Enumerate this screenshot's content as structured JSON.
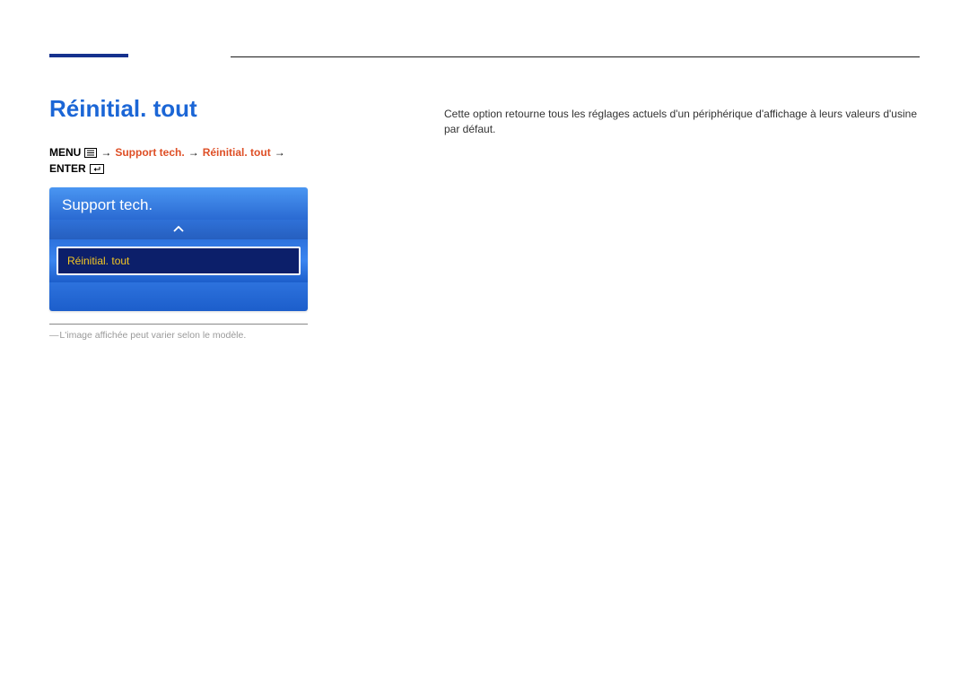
{
  "title": "Réinitial. tout",
  "breadcrumb": {
    "menu_label": "MENU",
    "arrow": "→",
    "path_highlight": "Support tech.",
    "path_highlight2": "Réinitial. tout",
    "enter_label": "ENTER"
  },
  "menu_widget": {
    "header": "Support tech.",
    "selected_item": "Réinitial. tout"
  },
  "footnote": "L'image affichée peut varier selon le modèle.",
  "description": "Cette option retourne tous les réglages actuels d'un périphérique d'affichage à leurs valeurs d'usine par défaut."
}
